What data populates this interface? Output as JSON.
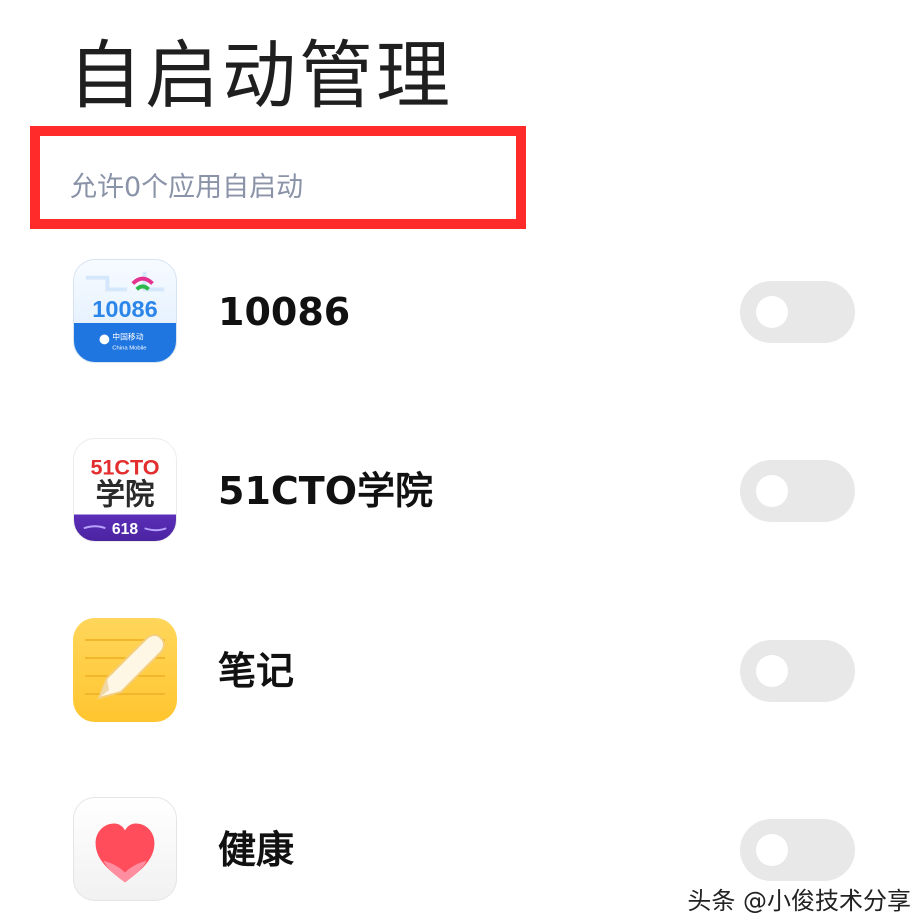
{
  "header": {
    "title": "自启动管理",
    "subtitle": "允许0个应用自启动"
  },
  "apps": [
    {
      "name": "10086",
      "icon": "china-mobile-10086-icon",
      "autostart_enabled": false,
      "icon_text": {
        "main": "10086",
        "brand": "中国移动",
        "brand_en": "China Mobile"
      }
    },
    {
      "name": "51CTO学院",
      "icon": "51cto-academy-icon",
      "autostart_enabled": false,
      "icon_text": {
        "top": "51CTO",
        "bottom": "学院",
        "badge": "618"
      }
    },
    {
      "name": "笔记",
      "icon": "notes-icon",
      "autostart_enabled": false
    },
    {
      "name": "健康",
      "icon": "health-heart-icon",
      "autostart_enabled": false
    }
  ],
  "watermark": "头条 @小俊技术分享",
  "colors": {
    "highlight_border": "#ff2a2a",
    "subtitle": "#8a93a8",
    "toggle_off": "#e8e8e8"
  }
}
